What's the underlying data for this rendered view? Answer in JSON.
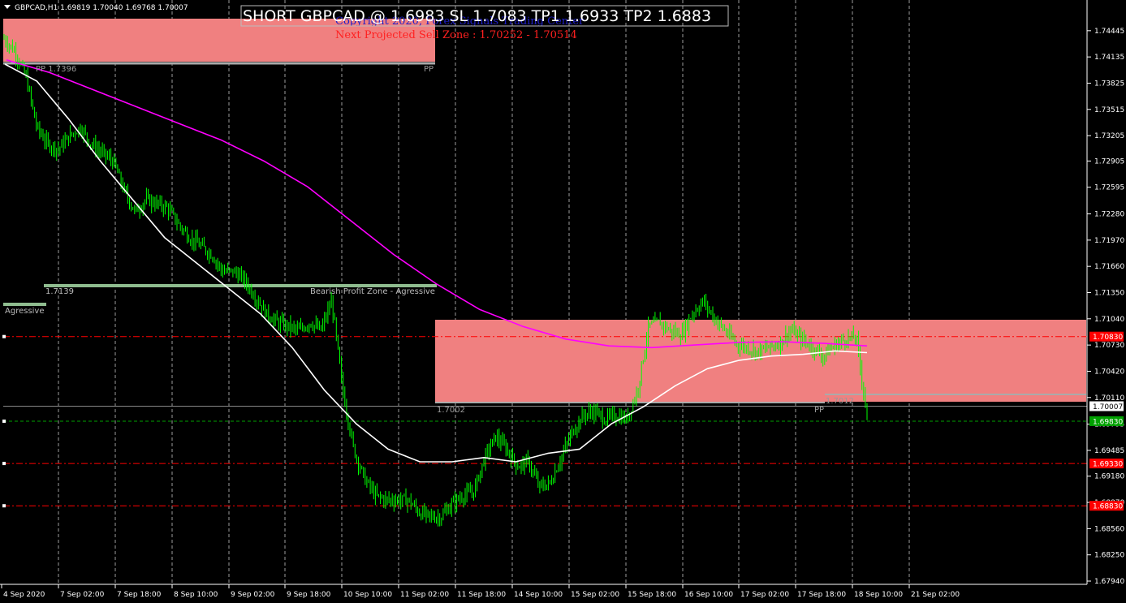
{
  "window": {
    "symbol_line": "GBPCAD,H1  1.69819 1.70040 1.69768 1.70007"
  },
  "annotations": {
    "signal": "SHORT GBPCAD @ 1.6983 SL 1.7083 TP1 1.6933 TP2 1.6883",
    "copyright": "Copyright 2020, Forex Signals Trading Center",
    "projected_zone": "Next Projected Sell Zone : 1.70252 - 1.70514",
    "pp_top_left": "PP 1.7396",
    "pp_top_right": "PP",
    "profit_zone": "Bearish Profit Zone - Agressive",
    "profit_level": "1.7139",
    "agressive": "Agressive",
    "pp_mid_left": "1.7002",
    "pp_mid_right_label": "PP",
    "pp_mid_right_level": "1.7012"
  },
  "colors": {
    "background": "#000000",
    "candles": "#00ff00",
    "ma_fast": "#ffffff",
    "ma_slow": "#ff00ff",
    "zone": "#f08080",
    "profit_zone": "#8fbc8f",
    "sl_line": "#ff0000",
    "entry_line": "#00a000"
  },
  "chart_data": {
    "type": "line",
    "ylim": [
      1.6794,
      1.7476
    ],
    "y_ticks": [
      "1.74445",
      "1.74135",
      "1.73825",
      "1.73515",
      "1.73205",
      "1.72905",
      "1.72595",
      "1.72280",
      "1.71970",
      "1.71660",
      "1.71350",
      "1.71040",
      "1.70730",
      "1.70420",
      "1.70110",
      "1.69795",
      "1.69485",
      "1.69180",
      "1.68870",
      "1.68560",
      "1.68250",
      "1.67940"
    ],
    "x_ticks": [
      "4 Sep 2020",
      "7 Sep 02:00",
      "7 Sep 18:00",
      "8 Sep 10:00",
      "9 Sep 02:00",
      "9 Sep 18:00",
      "10 Sep 10:00",
      "11 Sep 02:00",
      "11 Sep 18:00",
      "14 Sep 10:00",
      "15 Sep 02:00",
      "15 Sep 18:00",
      "16 Sep 10:00",
      "17 Sep 02:00",
      "17 Sep 18:00",
      "18 Sep 10:00",
      "21 Sep 02:00"
    ],
    "price_series": {
      "name": "GBPCAD H1 close",
      "values": [
        1.7435,
        1.742,
        1.739,
        1.733,
        1.731,
        1.7305,
        1.732,
        1.733,
        1.731,
        1.73,
        1.729,
        1.7255,
        1.723,
        1.7245,
        1.724,
        1.7235,
        1.7215,
        1.72,
        1.719,
        1.718,
        1.716,
        1.716,
        1.715,
        1.713,
        1.711,
        1.71,
        1.7095,
        1.709,
        1.71,
        1.709,
        1.7125,
        1.702,
        1.695,
        1.6915,
        1.6895,
        1.689,
        1.689,
        1.689,
        1.6875,
        1.687,
        1.687,
        1.6885,
        1.6895,
        1.69,
        1.694,
        1.6965,
        1.695,
        1.693,
        1.6935,
        1.6905,
        1.691,
        1.694,
        1.697,
        1.699,
        1.6995,
        1.6985,
        1.699,
        1.6985,
        1.702,
        1.7095,
        1.71,
        1.709,
        1.7085,
        1.711,
        1.7125,
        1.7105,
        1.709,
        1.7075,
        1.707,
        1.7065,
        1.707,
        1.7075,
        1.709,
        1.708,
        1.707,
        1.706,
        1.7072,
        1.708,
        1.7082,
        1.699
      ]
    },
    "ma_fast": {
      "name": "MA fast",
      "values": [
        1.7405,
        1.7385,
        1.734,
        1.729,
        1.7245,
        1.72,
        1.717,
        1.714,
        1.711,
        1.707,
        1.702,
        1.698,
        1.695,
        1.6935,
        1.6935,
        1.694,
        1.6935,
        1.6945,
        1.695,
        1.698,
        1.7,
        1.7025,
        1.7045,
        1.7055,
        1.706,
        1.7062,
        1.7066,
        1.7064
      ]
    },
    "ma_slow": {
      "name": "MA slow",
      "values": [
        1.741,
        1.7395,
        1.7375,
        1.7355,
        1.7335,
        1.7315,
        1.729,
        1.726,
        1.722,
        1.718,
        1.7145,
        1.7115,
        1.7095,
        1.708,
        1.7072,
        1.707,
        1.7073,
        1.7076,
        1.7077,
        1.7075,
        1.7072
      ]
    },
    "levels": {
      "current": 1.70007,
      "stop_loss": 1.7083,
      "entry": 1.6983,
      "tp1": 1.6933,
      "tp2": 1.6883
    },
    "price_badges": {
      "stop_loss": "1.70830",
      "current": "1.70007",
      "entry": "1.69830",
      "tp1": "1.69330",
      "tp2": "1.68830"
    }
  }
}
